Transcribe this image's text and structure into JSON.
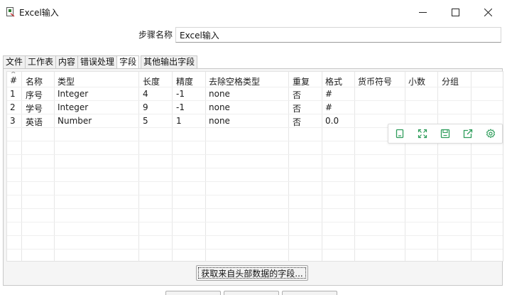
{
  "window": {
    "title": "Excel输入",
    "icon": "excel-input-icon"
  },
  "step": {
    "label": "步骤名称",
    "value": "Excel输入"
  },
  "tabs": [
    {
      "label": "文件"
    },
    {
      "label": "工作表"
    },
    {
      "label": "内容"
    },
    {
      "label": "错误处理"
    },
    {
      "label": "字段",
      "active": true
    },
    {
      "label": "其他输出字段"
    }
  ],
  "table": {
    "headers": [
      "#",
      "名称",
      "类型",
      "长度",
      "精度",
      "去除空格类型",
      "重复",
      "格式",
      "货币符号",
      "小数",
      "分组"
    ],
    "rows": [
      [
        "1",
        "序号",
        "Integer",
        "4",
        "-1",
        "none",
        "否",
        "#",
        "",
        "",
        ""
      ],
      [
        "2",
        "学号",
        "Integer",
        "9",
        "-1",
        "none",
        "否",
        "#",
        "",
        "",
        ""
      ],
      [
        "3",
        "英语",
        "Number",
        "5",
        "1",
        "none",
        "否",
        "0.0",
        "",
        "",
        ""
      ]
    ]
  },
  "float_toolbar": {
    "icons": [
      "copy-icon",
      "expand-icon",
      "save-icon",
      "share-icon",
      "settings-icon"
    ],
    "accent_color": "#2e9d5b"
  },
  "fetch_button": {
    "label": "获取来自头部数据的字段..."
  }
}
